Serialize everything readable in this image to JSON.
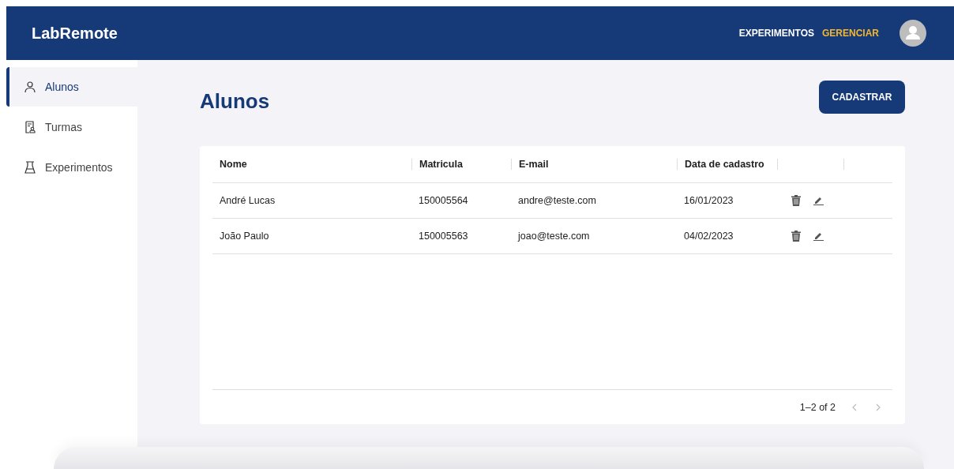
{
  "header": {
    "logo": "LabRemote",
    "nav": [
      {
        "label": "EXPERIMENTOS",
        "selected": false
      },
      {
        "label": "GERENCIAR",
        "selected": true
      }
    ]
  },
  "sidebar": {
    "items": [
      {
        "label": "Alunos",
        "kind": "person",
        "selected": true
      },
      {
        "label": "Turmas",
        "kind": "roster",
        "selected": false
      },
      {
        "label": "Experimentos",
        "kind": "flask",
        "selected": false
      }
    ]
  },
  "page": {
    "title": "Alunos",
    "button": "CADASTRAR"
  },
  "table": {
    "columns": [
      "Nome",
      "Matricula",
      "E-mail",
      "Data de cadastro"
    ],
    "rows": [
      {
        "cells": [
          "André Lucas",
          "150005564",
          "andre@teste.com",
          "16/01/2023"
        ]
      },
      {
        "cells": [
          "João Paulo",
          "150005563",
          "joao@teste.com",
          "04/02/2023"
        ]
      }
    ],
    "pagination": {
      "range": "1–2 of 2",
      "prev_disabled": true,
      "next_disabled": true
    }
  }
}
